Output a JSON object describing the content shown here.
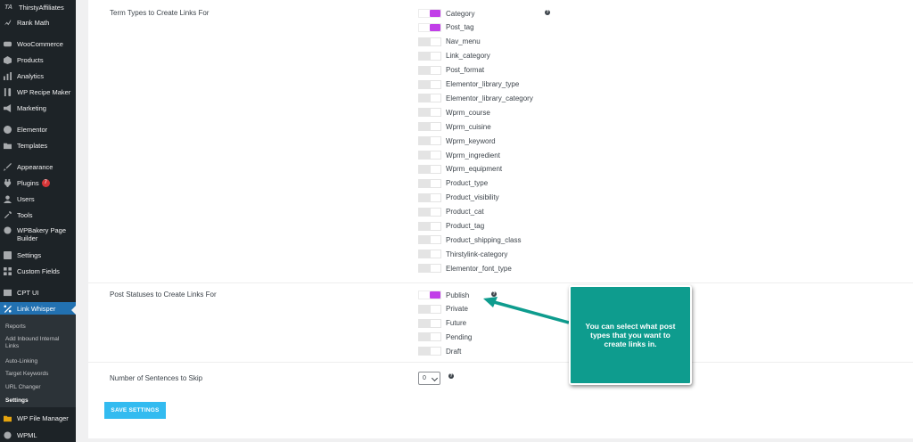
{
  "sidebar": {
    "items": [
      {
        "label": "ThirstyAffiliates",
        "icon": "ta-logo-icon"
      },
      {
        "label": "Rank Math",
        "icon": "chart-icon"
      },
      {
        "label": "WooCommerce",
        "icon": "woo-icon"
      },
      {
        "label": "Products",
        "icon": "box-icon"
      },
      {
        "label": "Analytics",
        "icon": "bar-chart-icon"
      },
      {
        "label": "WP Recipe Maker",
        "icon": "utensils-icon"
      },
      {
        "label": "Marketing",
        "icon": "megaphone-icon"
      },
      {
        "label": "Elementor",
        "icon": "elementor-icon"
      },
      {
        "label": "Templates",
        "icon": "folder-icon"
      },
      {
        "label": "Appearance",
        "icon": "brush-icon"
      },
      {
        "label": "Plugins",
        "icon": "plug-icon",
        "badge": "7"
      },
      {
        "label": "Users",
        "icon": "user-icon"
      },
      {
        "label": "Tools",
        "icon": "wrench-icon"
      },
      {
        "label": "WPBakery Page Builder",
        "icon": "bakery-icon"
      },
      {
        "label": "Settings",
        "icon": "settings-icon"
      },
      {
        "label": "Custom Fields",
        "icon": "grid-icon"
      },
      {
        "label": "CPT UI",
        "icon": "cpt-icon"
      },
      {
        "label": "Link Whisper",
        "icon": "link-icon"
      },
      {
        "label": "WP File Manager",
        "icon": "file-manager-icon"
      },
      {
        "label": "WPML",
        "icon": "globe-icon"
      }
    ],
    "submenu": [
      "Reports",
      "Add Inbound Internal Links",
      "Auto-Linking",
      "Target Keywords",
      "URL Changer",
      "Settings"
    ]
  },
  "settings": {
    "term_types": {
      "label": "Term Types to Create Links For",
      "options": [
        {
          "label": "Category",
          "checked": true
        },
        {
          "label": "Post_tag",
          "checked": true
        },
        {
          "label": "Nav_menu",
          "checked": false
        },
        {
          "label": "Link_category",
          "checked": false
        },
        {
          "label": "Post_format",
          "checked": false
        },
        {
          "label": "Elementor_library_type",
          "checked": false
        },
        {
          "label": "Elementor_library_category",
          "checked": false
        },
        {
          "label": "Wprm_course",
          "checked": false
        },
        {
          "label": "Wprm_cuisine",
          "checked": false
        },
        {
          "label": "Wprm_keyword",
          "checked": false
        },
        {
          "label": "Wprm_ingredient",
          "checked": false
        },
        {
          "label": "Wprm_equipment",
          "checked": false
        },
        {
          "label": "Product_type",
          "checked": false
        },
        {
          "label": "Product_visibility",
          "checked": false
        },
        {
          "label": "Product_cat",
          "checked": false
        },
        {
          "label": "Product_tag",
          "checked": false
        },
        {
          "label": "Product_shipping_class",
          "checked": false
        },
        {
          "label": "Thirstylink-category",
          "checked": false
        },
        {
          "label": "Elementor_font_type",
          "checked": false
        }
      ]
    },
    "post_statuses": {
      "label": "Post Statuses to Create Links For",
      "options": [
        {
          "label": "Publish",
          "checked": true
        },
        {
          "label": "Private",
          "checked": false
        },
        {
          "label": "Future",
          "checked": false
        },
        {
          "label": "Pending",
          "checked": false
        },
        {
          "label": "Draft",
          "checked": false
        }
      ]
    },
    "sentences_skip": {
      "label": "Number of Sentences to Skip",
      "value": "0"
    },
    "help_glyph": "?",
    "save_label": "SAVE SETTINGS"
  },
  "callout": {
    "text": "You can select what post types that you want to create links in."
  },
  "colors": {
    "accent": "#c13ee8",
    "sidebar_bg": "#1d2327",
    "active_menu": "#2271b1",
    "button": "#33bbf0",
    "callout": "#0e9c8e"
  }
}
